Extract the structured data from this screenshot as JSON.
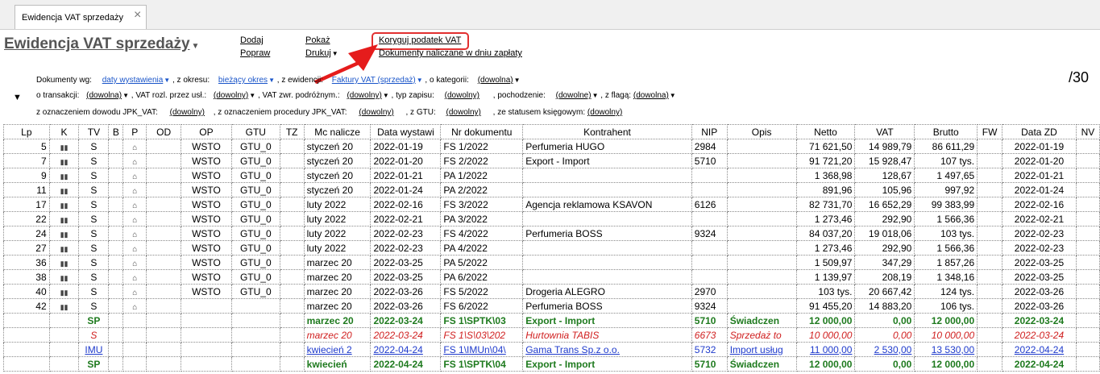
{
  "tab": {
    "label": "Ewidencja VAT sprzedaży"
  },
  "header": {
    "title": "Ewidencja VAT sprzedaży",
    "page_count": "/30"
  },
  "menu": {
    "dodaj": "Dodaj",
    "popraw": "Popraw",
    "pokaz": "Pokaż",
    "drukuj": "Drukuj",
    "koryguj": "Koryguj podatek VAT",
    "dokumenty": "Dokumenty naliczane w dniu zapłaty"
  },
  "filters": {
    "dok_wg_label": "Dokumenty wg:",
    "dok_wg_value": "daty wystawienia",
    "okres_label": ", z okresu:",
    "okres_value": "bieżący okres",
    "ewid_label": ", z ewidencji:",
    "ewid_value": "Faktury VAT (sprzedaż)",
    "kat_label": ", o kategorii:",
    "kat_value": "(dowolna)",
    "trans_label": "o transakcji:",
    "trans_value": "(dowolna)",
    "vatrozl_label": ", VAT rozl. przez usł.:",
    "vatrozl_value": "(dowolny)",
    "vatzwr_label": ", VAT zwr. podróżnym.:",
    "vatzwr_value": "(dowolny)",
    "typ_label": ", typ zapisu:",
    "typ_value": "(dowolny)",
    "poch_label": ", pochodzenie:",
    "poch_value": "(dowolne)",
    "flaga_label": ", z flagą:",
    "flaga_value": "(dowolna)",
    "jpk_label": "z oznaczeniem dowodu JPK_VAT:",
    "jpk_value": "(dowolny)",
    "proc_label": ", z oznaczeniem procedury JPK_VAT:",
    "proc_value": "(dowolny)",
    "gtu_label": ", z GTU:",
    "gtu_value": "(dowolny)",
    "status_label": ", ze statusem księgowym:",
    "status_value": "(dowolny)"
  },
  "table": {
    "columns": [
      "Lp",
      "K",
      "TV",
      "B",
      "P",
      "OD",
      "OP",
      "GTU",
      "TZ",
      "Mc nalicze",
      "Data wystawi",
      "Nr dokumentu",
      "Kontrahent",
      "NIP",
      "Opis",
      "Netto",
      "VAT",
      "Brutto",
      "FW",
      "Data ZD",
      "NV"
    ],
    "rows": [
      {
        "lp": "5",
        "tv": "S",
        "op": "WSTO",
        "gtu": "GTU_0",
        "mc": "styczeń 20",
        "data": "2022-01-19",
        "nr": "FS 1/2022",
        "kontr": "Perfumeria HUGO",
        "nip": "2984",
        "opis": "",
        "netto": "71 621,50",
        "vat": "14 989,79",
        "brutto": "86 611,29",
        "zd": "2022-01-19"
      },
      {
        "lp": "7",
        "tv": "S",
        "op": "WSTO",
        "gtu": "GTU_0",
        "mc": "styczeń 20",
        "data": "2022-01-20",
        "nr": "FS 2/2022",
        "kontr": "Export - Import",
        "nip": "5710",
        "opis": "",
        "netto": "91 721,20",
        "vat": "15 928,47",
        "brutto": "107 tys.",
        "zd": "2022-01-20"
      },
      {
        "lp": "9",
        "tv": "S",
        "op": "WSTO",
        "gtu": "GTU_0",
        "mc": "styczeń 20",
        "data": "2022-01-21",
        "nr": "PA 1/2022",
        "kontr": "",
        "nip": "",
        "opis": "",
        "netto": "1 368,98",
        "vat": "128,67",
        "brutto": "1 497,65",
        "zd": "2022-01-21"
      },
      {
        "lp": "11",
        "tv": "S",
        "op": "WSTO",
        "gtu": "GTU_0",
        "mc": "styczeń 20",
        "data": "2022-01-24",
        "nr": "PA 2/2022",
        "kontr": "",
        "nip": "",
        "opis": "",
        "netto": "891,96",
        "vat": "105,96",
        "brutto": "997,92",
        "zd": "2022-01-24"
      },
      {
        "lp": "17",
        "tv": "S",
        "op": "WSTO",
        "gtu": "GTU_0",
        "mc": "luty 2022",
        "data": "2022-02-16",
        "nr": "FS 3/2022",
        "kontr": "Agencja reklamowa KSAVON",
        "nip": "6126",
        "opis": "",
        "netto": "82 731,70",
        "vat": "16 652,29",
        "brutto": "99 383,99",
        "zd": "2022-02-16"
      },
      {
        "lp": "22",
        "tv": "S",
        "op": "WSTO",
        "gtu": "GTU_0",
        "mc": "luty 2022",
        "data": "2022-02-21",
        "nr": "PA 3/2022",
        "kontr": "",
        "nip": "",
        "opis": "",
        "netto": "1 273,46",
        "vat": "292,90",
        "brutto": "1 566,36",
        "zd": "2022-02-21"
      },
      {
        "lp": "24",
        "tv": "S",
        "op": "WSTO",
        "gtu": "GTU_0",
        "mc": "luty 2022",
        "data": "2022-02-23",
        "nr": "FS 4/2022",
        "kontr": "Perfumeria BOSS",
        "nip": "9324",
        "opis": "",
        "netto": "84 037,20",
        "vat": "19 018,06",
        "brutto": "103 tys.",
        "zd": "2022-02-23"
      },
      {
        "lp": "27",
        "tv": "S",
        "op": "WSTO",
        "gtu": "GTU_0",
        "mc": "luty 2022",
        "data": "2022-02-23",
        "nr": "PA 4/2022",
        "kontr": "",
        "nip": "",
        "opis": "",
        "netto": "1 273,46",
        "vat": "292,90",
        "brutto": "1 566,36",
        "zd": "2022-02-23"
      },
      {
        "lp": "36",
        "tv": "S",
        "op": "WSTO",
        "gtu": "GTU_0",
        "mc": "marzec 20",
        "data": "2022-03-25",
        "nr": "PA 5/2022",
        "kontr": "",
        "nip": "",
        "opis": "",
        "netto": "1 509,97",
        "vat": "347,29",
        "brutto": "1 857,26",
        "zd": "2022-03-25"
      },
      {
        "lp": "38",
        "tv": "S",
        "op": "WSTO",
        "gtu": "GTU_0",
        "mc": "marzec 20",
        "data": "2022-03-25",
        "nr": "PA 6/2022",
        "kontr": "",
        "nip": "",
        "opis": "",
        "netto": "1 139,97",
        "vat": "208,19",
        "brutto": "1 348,16",
        "zd": "2022-03-25"
      },
      {
        "lp": "40",
        "tv": "S",
        "op": "WSTO",
        "gtu": "GTU_0",
        "mc": "marzec 20",
        "data": "2022-03-26",
        "nr": "FS 5/2022",
        "kontr": "Drogeria ALEGRO",
        "nip": "2970",
        "opis": "",
        "netto": "103 tys.",
        "vat": "20 667,42",
        "brutto": "124 tys.",
        "zd": "2022-03-26"
      },
      {
        "lp": "42",
        "tv": "S",
        "op": "",
        "gtu": "",
        "mc": "marzec 20",
        "data": "2022-03-26",
        "nr": "FS 6/2022",
        "kontr": "Perfumeria BOSS",
        "nip": "9324",
        "opis": "",
        "netto": "91 455,20",
        "vat": "14 883,20",
        "brutto": "106 tys.",
        "zd": "2022-03-26"
      },
      {
        "lp": "",
        "tv": "SP",
        "op": "",
        "gtu": "",
        "mc": "marzec 20",
        "data": "2022-03-24",
        "nr": "FS 1\\SPTK\\03",
        "kontr": "Export - Import",
        "nip": "5710",
        "opis": "Świadczen",
        "netto": "12 000,00",
        "vat": "0,00",
        "brutto": "12 000,00",
        "zd": "2022-03-24"
      },
      {
        "lp": "",
        "tv": "S",
        "op": "",
        "gtu": "",
        "mc": "marzec 20",
        "data": "2022-03-24",
        "nr": "FS 1\\S\\03\\202",
        "kontr": "Hurtownia TABIS",
        "nip": "6673",
        "opis": "Sprzedaż to",
        "netto": "10 000,00",
        "vat": "0,00",
        "brutto": "10 000,00",
        "zd": "2022-03-24"
      },
      {
        "lp": "",
        "tv": "IMU",
        "op": "",
        "gtu": "",
        "mc": "kwiecień 2",
        "data": "2022-04-24",
        "nr": "FS 1\\IMUn\\04\\",
        "kontr": "Gama Trans Sp.z o.o.",
        "nip": "5732",
        "opis": "Import usług",
        "netto": "11 000,00",
        "vat": "2 530,00",
        "brutto": "13 530,00",
        "zd": "2022-04-24"
      },
      {
        "lp": "",
        "tv": "SP",
        "op": "",
        "gtu": "",
        "mc": "kwiecień",
        "data": "2022-04-24",
        "nr": "FS 1\\SPTK\\04",
        "kontr": "Export - Import",
        "nip": "5710",
        "opis": "Świadczen",
        "netto": "12 000,00",
        "vat": "0,00",
        "brutto": "12 000,00",
        "zd": "2022-04-24"
      }
    ]
  }
}
